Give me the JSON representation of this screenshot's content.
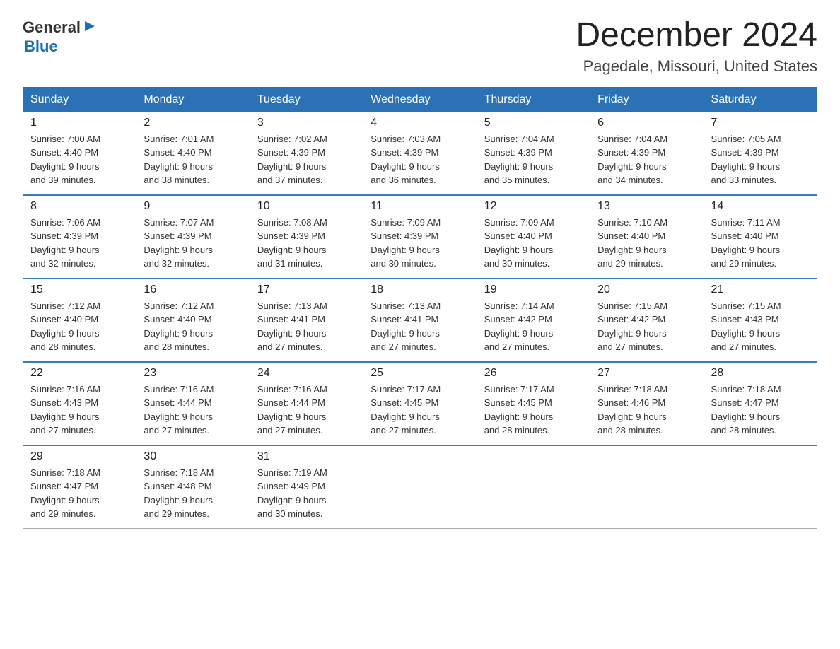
{
  "logo": {
    "general": "General",
    "blue": "Blue",
    "arrow": "▶"
  },
  "title": {
    "month": "December 2024",
    "location": "Pagedale, Missouri, United States"
  },
  "weekdays": [
    "Sunday",
    "Monday",
    "Tuesday",
    "Wednesday",
    "Thursday",
    "Friday",
    "Saturday"
  ],
  "weeks": [
    [
      {
        "day": "1",
        "sunrise": "7:00 AM",
        "sunset": "4:40 PM",
        "daylight": "9 hours and 39 minutes."
      },
      {
        "day": "2",
        "sunrise": "7:01 AM",
        "sunset": "4:40 PM",
        "daylight": "9 hours and 38 minutes."
      },
      {
        "day": "3",
        "sunrise": "7:02 AM",
        "sunset": "4:39 PM",
        "daylight": "9 hours and 37 minutes."
      },
      {
        "day": "4",
        "sunrise": "7:03 AM",
        "sunset": "4:39 PM",
        "daylight": "9 hours and 36 minutes."
      },
      {
        "day": "5",
        "sunrise": "7:04 AM",
        "sunset": "4:39 PM",
        "daylight": "9 hours and 35 minutes."
      },
      {
        "day": "6",
        "sunrise": "7:04 AM",
        "sunset": "4:39 PM",
        "daylight": "9 hours and 34 minutes."
      },
      {
        "day": "7",
        "sunrise": "7:05 AM",
        "sunset": "4:39 PM",
        "daylight": "9 hours and 33 minutes."
      }
    ],
    [
      {
        "day": "8",
        "sunrise": "7:06 AM",
        "sunset": "4:39 PM",
        "daylight": "9 hours and 32 minutes."
      },
      {
        "day": "9",
        "sunrise": "7:07 AM",
        "sunset": "4:39 PM",
        "daylight": "9 hours and 32 minutes."
      },
      {
        "day": "10",
        "sunrise": "7:08 AM",
        "sunset": "4:39 PM",
        "daylight": "9 hours and 31 minutes."
      },
      {
        "day": "11",
        "sunrise": "7:09 AM",
        "sunset": "4:39 PM",
        "daylight": "9 hours and 30 minutes."
      },
      {
        "day": "12",
        "sunrise": "7:09 AM",
        "sunset": "4:40 PM",
        "daylight": "9 hours and 30 minutes."
      },
      {
        "day": "13",
        "sunrise": "7:10 AM",
        "sunset": "4:40 PM",
        "daylight": "9 hours and 29 minutes."
      },
      {
        "day": "14",
        "sunrise": "7:11 AM",
        "sunset": "4:40 PM",
        "daylight": "9 hours and 29 minutes."
      }
    ],
    [
      {
        "day": "15",
        "sunrise": "7:12 AM",
        "sunset": "4:40 PM",
        "daylight": "9 hours and 28 minutes."
      },
      {
        "day": "16",
        "sunrise": "7:12 AM",
        "sunset": "4:40 PM",
        "daylight": "9 hours and 28 minutes."
      },
      {
        "day": "17",
        "sunrise": "7:13 AM",
        "sunset": "4:41 PM",
        "daylight": "9 hours and 27 minutes."
      },
      {
        "day": "18",
        "sunrise": "7:13 AM",
        "sunset": "4:41 PM",
        "daylight": "9 hours and 27 minutes."
      },
      {
        "day": "19",
        "sunrise": "7:14 AM",
        "sunset": "4:42 PM",
        "daylight": "9 hours and 27 minutes."
      },
      {
        "day": "20",
        "sunrise": "7:15 AM",
        "sunset": "4:42 PM",
        "daylight": "9 hours and 27 minutes."
      },
      {
        "day": "21",
        "sunrise": "7:15 AM",
        "sunset": "4:43 PM",
        "daylight": "9 hours and 27 minutes."
      }
    ],
    [
      {
        "day": "22",
        "sunrise": "7:16 AM",
        "sunset": "4:43 PM",
        "daylight": "9 hours and 27 minutes."
      },
      {
        "day": "23",
        "sunrise": "7:16 AM",
        "sunset": "4:44 PM",
        "daylight": "9 hours and 27 minutes."
      },
      {
        "day": "24",
        "sunrise": "7:16 AM",
        "sunset": "4:44 PM",
        "daylight": "9 hours and 27 minutes."
      },
      {
        "day": "25",
        "sunrise": "7:17 AM",
        "sunset": "4:45 PM",
        "daylight": "9 hours and 27 minutes."
      },
      {
        "day": "26",
        "sunrise": "7:17 AM",
        "sunset": "4:45 PM",
        "daylight": "9 hours and 28 minutes."
      },
      {
        "day": "27",
        "sunrise": "7:18 AM",
        "sunset": "4:46 PM",
        "daylight": "9 hours and 28 minutes."
      },
      {
        "day": "28",
        "sunrise": "7:18 AM",
        "sunset": "4:47 PM",
        "daylight": "9 hours and 28 minutes."
      }
    ],
    [
      {
        "day": "29",
        "sunrise": "7:18 AM",
        "sunset": "4:47 PM",
        "daylight": "9 hours and 29 minutes."
      },
      {
        "day": "30",
        "sunrise": "7:18 AM",
        "sunset": "4:48 PM",
        "daylight": "9 hours and 29 minutes."
      },
      {
        "day": "31",
        "sunrise": "7:19 AM",
        "sunset": "4:49 PM",
        "daylight": "9 hours and 30 minutes."
      },
      null,
      null,
      null,
      null
    ]
  ]
}
